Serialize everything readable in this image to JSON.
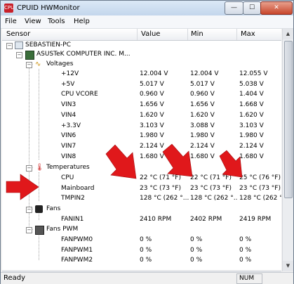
{
  "window": {
    "title": "CPUID HWMonitor",
    "icon_label": "CPU",
    "controls": {
      "minimize": "—",
      "maximize": "☐",
      "close": "✕"
    },
    "accent_color": "#c8202a"
  },
  "menu": [
    "File",
    "View",
    "Tools",
    "Help"
  ],
  "columns": {
    "sensor": "Sensor",
    "value": "Value",
    "min": "Min",
    "max": "Max"
  },
  "tree": {
    "computer": "SEBASTIEN-PC",
    "board": "ASUSTeK COMPUTER INC. M...",
    "voltages": {
      "label": "Voltages",
      "rows": [
        {
          "name": "+12V",
          "value": "12.004 V",
          "min": "12.004 V",
          "max": "12.055 V"
        },
        {
          "name": "+5V",
          "value": "5.017 V",
          "min": "5.017 V",
          "max": "5.038 V"
        },
        {
          "name": "CPU VCORE",
          "value": "0.960 V",
          "min": "0.960 V",
          "max": "1.404 V"
        },
        {
          "name": "VIN3",
          "value": "1.656 V",
          "min": "1.656 V",
          "max": "1.668 V"
        },
        {
          "name": "VIN4",
          "value": "1.620 V",
          "min": "1.620 V",
          "max": "1.620 V"
        },
        {
          "name": "+3.3V",
          "value": "3.103 V",
          "min": "3.088 V",
          "max": "3.103 V"
        },
        {
          "name": "VIN6",
          "value": "1.980 V",
          "min": "1.980 V",
          "max": "1.980 V"
        },
        {
          "name": "VIN7",
          "value": "2.124 V",
          "min": "2.124 V",
          "max": "2.124 V"
        },
        {
          "name": "VIN8",
          "value": "1.680 V",
          "min": "1.680 V",
          "max": "1.680 V"
        }
      ]
    },
    "temperatures": {
      "label": "Temperatures",
      "rows": [
        {
          "name": "CPU",
          "value": "22 °C  (71 °F)",
          "min": "22 °C  (71 °F)",
          "max": "25 °C  (76 °F)"
        },
        {
          "name": "Mainboard",
          "value": "23 °C  (73 °F)",
          "min": "23 °C  (73 °F)",
          "max": "23 °C  (73 °F)"
        },
        {
          "name": "TMPIN2",
          "value": "128 °C  (262 °...",
          "min": "128 °C  (262 °...",
          "max": "128 °C  (262 °..."
        }
      ]
    },
    "fans": {
      "label": "Fans",
      "rows": [
        {
          "name": "FANIN1",
          "value": "2410 RPM",
          "min": "2402 RPM",
          "max": "2419 RPM"
        }
      ]
    },
    "fans_pwm": {
      "label": "Fans PWM",
      "rows": [
        {
          "name": "FANPWM0",
          "value": "0 %",
          "min": "0 %",
          "max": "0 %"
        },
        {
          "name": "FANPWM1",
          "value": "0 %",
          "min": "0 %",
          "max": "0 %"
        },
        {
          "name": "FANPWM2",
          "value": "0 %",
          "min": "0 %",
          "max": "0 %"
        }
      ]
    }
  },
  "status": {
    "text": "Ready",
    "num": "NUM"
  },
  "annotations": {
    "arrow_color": "#e0181b"
  }
}
